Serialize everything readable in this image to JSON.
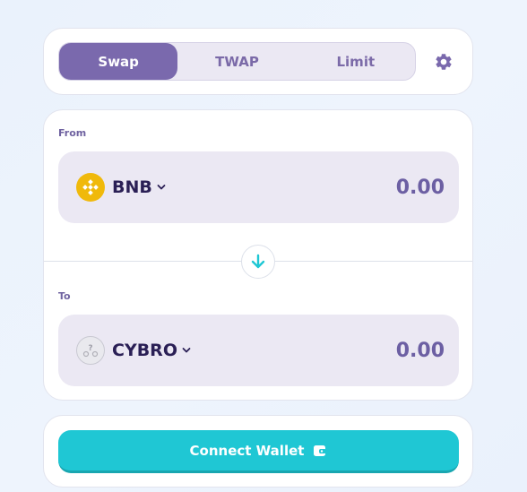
{
  "tabs": [
    {
      "label": "Swap",
      "active": true
    },
    {
      "label": "TWAP",
      "active": false
    },
    {
      "label": "Limit",
      "active": false
    }
  ],
  "settings_icon": "gear-icon",
  "from": {
    "label": "From",
    "token": "BNB",
    "token_icon": "bnb-token-icon",
    "amount_placeholder": "0.00"
  },
  "to": {
    "label": "To",
    "token": "CYBRO",
    "token_icon": "unknown-token-icon",
    "amount_placeholder": "0.00"
  },
  "switch_icon": "arrow-down-icon",
  "connect": {
    "label": "Connect Wallet",
    "icon": "wallet-icon"
  },
  "colors": {
    "accent": "#7a69ad",
    "primary_button": "#1fc7d4",
    "bnb": "#f0b90b",
    "arrow": "#1fc7d4"
  }
}
